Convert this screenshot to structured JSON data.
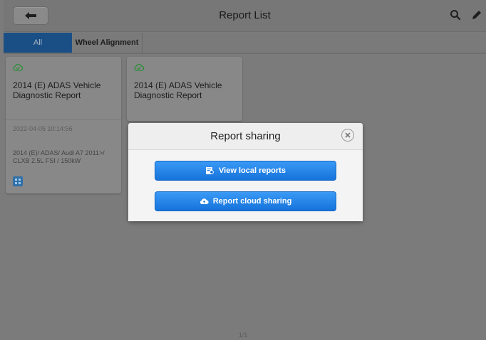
{
  "header": {
    "title": "Report List",
    "icons": {
      "back": "back-arrow-icon",
      "search": "search-icon",
      "edit": "pencil-icon"
    }
  },
  "tabs": [
    {
      "label": "All",
      "selected": true
    },
    {
      "label": "Wheel Alignment",
      "selected": false
    }
  ],
  "cards": [
    {
      "title": "2014 (E) ADAS Vehicle Diagnostic Report",
      "date": "2022-04-05 10:14:56",
      "vehicle": "2014 (E)/ ADAS/ Audi A7 2011>/ CLXB 2.5L FSI / 150kW",
      "status_icon": "check-cloud-icon"
    },
    {
      "title": "2014 (E) ADAS Vehicle Diagnostic Report",
      "status_icon": "check-cloud-icon"
    }
  ],
  "pagination": {
    "text": "1/1"
  },
  "modal": {
    "title": "Report sharing",
    "buttons": [
      {
        "label": "View local reports",
        "icon": "local-report-icon"
      },
      {
        "label": "Report cloud sharing",
        "icon": "cloud-upload-icon"
      }
    ]
  },
  "colors": {
    "accent": "#1a7ce0",
    "tab_selected": "#1a4f86",
    "check_green": "#2f8f3a"
  }
}
